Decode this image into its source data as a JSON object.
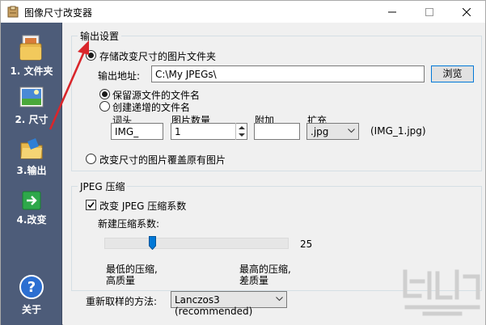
{
  "window": {
    "title": "图像尺寸改变器"
  },
  "sidebar": {
    "items": [
      {
        "label": "1. 文件夹",
        "icon": "folder-photos-icon"
      },
      {
        "label": "2. 尺寸",
        "icon": "image-resize-icon"
      },
      {
        "label": "3.输出",
        "icon": "output-folder-icon"
      },
      {
        "label": "4.改变",
        "icon": "green-arrow-icon"
      }
    ],
    "about": {
      "label": "关于",
      "icon": "help-icon"
    }
  },
  "output_settings": {
    "title": "输出设置",
    "store_option_label": "存储改变尺寸的图片文件夹",
    "output_path_label": "输出地址:",
    "output_path_value": "C:\\My JPEGs\\",
    "browse_label": "浏览",
    "keep_name_label": "保留源文件的文件名",
    "create_name_label": "创建递增的文件名",
    "prefix_label": "词头",
    "prefix_value": "IMG_",
    "count_label": "图片数量",
    "count_value": "1",
    "suffix_label": "附加",
    "suffix_value": "",
    "ext_label": "扩充",
    "ext_value": ".jpg",
    "preview": "(IMG_1.jpg)",
    "overwrite_label": "改变尺寸的图片覆盖原有图片"
  },
  "jpeg": {
    "title": "JPEG 压缩",
    "change_label": "改变 JPEG 压缩系数",
    "new_factor_label": "新建压缩系数:",
    "factor_value": "25",
    "factor_level": 0.25,
    "min_label_line1": "最低的压缩,",
    "min_label_line2": "高质量",
    "max_label_line1": "最高的压缩,",
    "max_label_line2": "差质量"
  },
  "resample": {
    "label": "重新取样的方法:",
    "value": "Lanczos3 (recommended)"
  },
  "colors": {
    "sidebar_bg": "#4d5c79",
    "accent": "#0078d7",
    "annotation_arrow": "#d9262b"
  }
}
